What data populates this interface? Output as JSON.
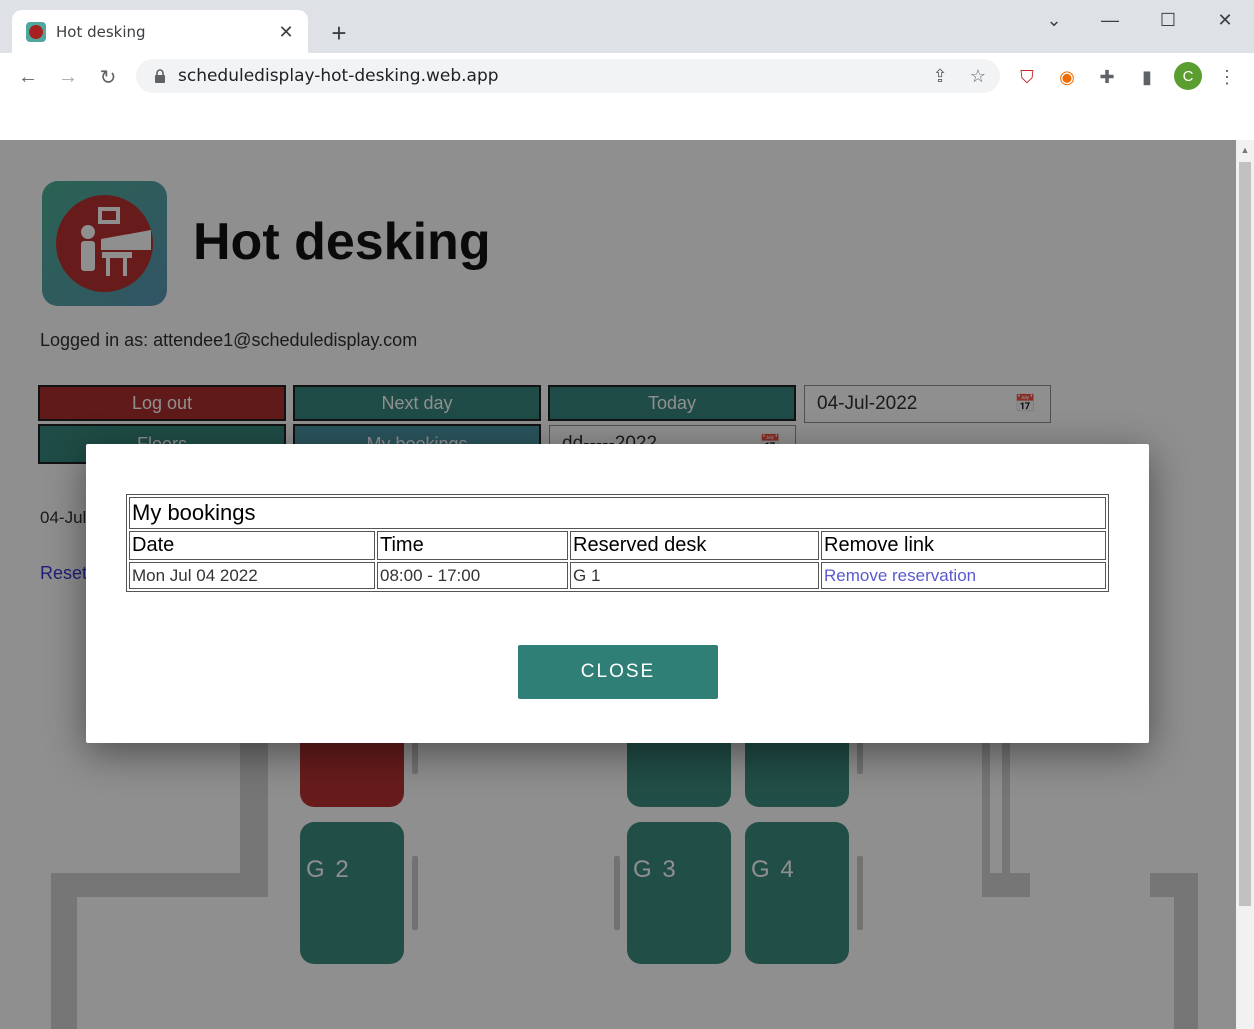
{
  "browser": {
    "tab_title": "Hot desking",
    "url": "scheduledisplay-hot-desking.web.app",
    "profile_initial": "C"
  },
  "app": {
    "title": "Hot desking",
    "logged_in_text": "Logged in as: attendee1@scheduledisplay.com",
    "buttons": {
      "log_out": "Log out",
      "next_day": "Next day",
      "today": "Today",
      "floors": "Floors",
      "my_bookings": "My bookings"
    },
    "date_value": "04-Jul-2022",
    "secondary_date_placeholder": "dd-----2022",
    "date_line": "04-Jul",
    "reset_link": "Reset"
  },
  "floor_plan": {
    "desks": [
      {
        "label": "",
        "status": "reserved"
      },
      {
        "label": "",
        "status": "available"
      },
      {
        "label": "",
        "status": "available"
      },
      {
        "label": "G 2",
        "status": "available"
      },
      {
        "label": "G 3",
        "status": "available"
      },
      {
        "label": "G 4",
        "status": "available"
      }
    ]
  },
  "modal": {
    "table_caption": "My bookings",
    "columns": [
      "Date",
      "Time",
      "Reserved desk",
      "Remove link"
    ],
    "rows": [
      {
        "date": "Mon Jul 04 2022",
        "time": "08:00 - 17:00",
        "desk": "G 1",
        "remove": "Remove reservation"
      }
    ],
    "close_label": "CLOSE"
  },
  "colors": {
    "brand_red": "#a8201f",
    "brand_teal": "#2a7f73",
    "link_blue": "#5a5ad0"
  }
}
